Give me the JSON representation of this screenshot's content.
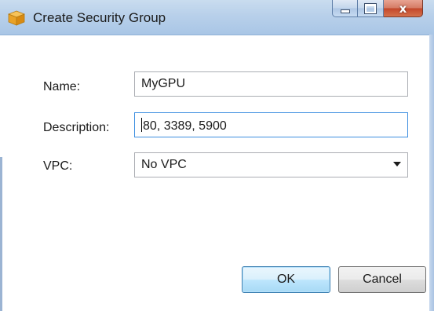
{
  "window": {
    "title": "Create Security Group",
    "icon": "package-icon",
    "close_glyph": "x"
  },
  "form": {
    "name_label": "Name:",
    "name_value": "MyGPU",
    "description_label": "Description:",
    "description_value": "80, 3389, 5900",
    "vpc_label": "VPC:",
    "vpc_value": "No VPC"
  },
  "buttons": {
    "ok_label": "OK",
    "cancel_label": "Cancel"
  },
  "colors": {
    "titlebar": "#b8d0ea",
    "focus_border": "#3d8ee0",
    "close_button": "#c3462a",
    "default_button_border": "#3c7fb1"
  }
}
